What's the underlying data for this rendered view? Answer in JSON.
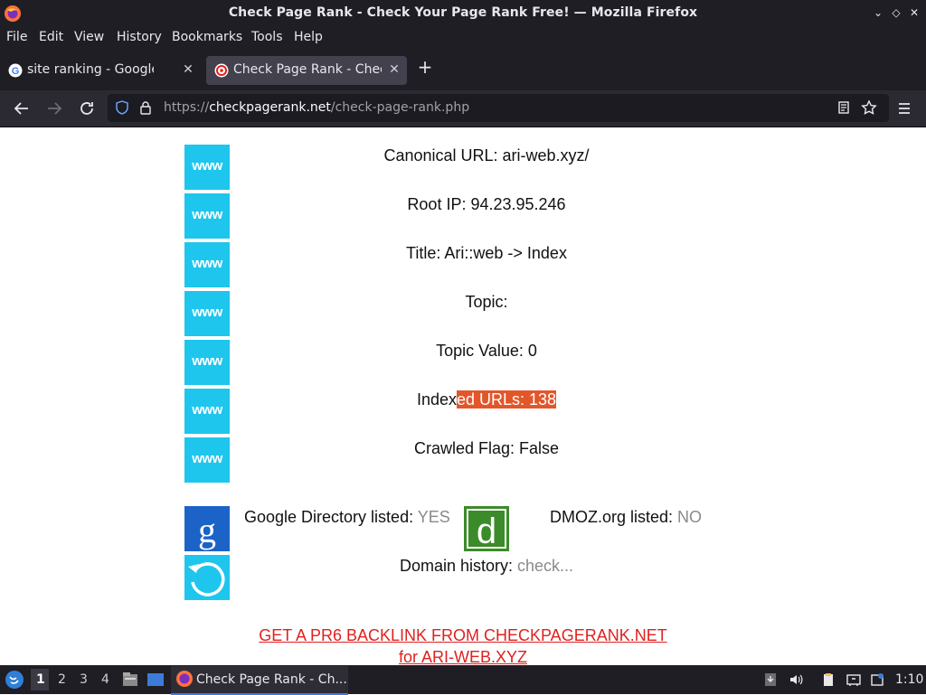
{
  "window": {
    "title": "Check Page Rank - Check Your Page Rank Free! — Mozilla Firefox"
  },
  "menu": [
    "File",
    "Edit",
    "View",
    "History",
    "Bookmarks",
    "Tools",
    "Help"
  ],
  "tabs": [
    {
      "label": "site ranking - Google Sea",
      "active": false
    },
    {
      "label": "Check Page Rank - Check",
      "active": true
    }
  ],
  "nav": {
    "url_prefix": "https://",
    "url_domain": "checkpagerank.net",
    "url_path": "/check-page-rank.php"
  },
  "page": {
    "www_icon_text": "www",
    "rows": [
      {
        "label": "Canonical URL: ari-web.xyz/"
      },
      {
        "label": "Root IP: 94.23.95.246"
      },
      {
        "label": "Title: Ari::web -> Index"
      },
      {
        "label": "Topic:"
      },
      {
        "label": "Topic Value: 0"
      },
      {
        "label_plain": "Index",
        "label_highlight": "ed URLs: 138"
      },
      {
        "label": "Crawled Flag: False"
      }
    ],
    "google_dir_label": "Google Directory listed: ",
    "google_dir_value": "YES",
    "google_icon_text": "g",
    "dmoz_icon_text": "d",
    "dmoz_label": "DMOZ.org listed: ",
    "dmoz_value": "NO",
    "domain_history_label": "Domain history: ",
    "domain_history_value": "check...",
    "backlink_line1": "GET A PR6 BACKLINK FROM CHECKPAGERANK.NET",
    "backlink_line2": "for ARI-WEB.XYZ"
  },
  "taskbar": {
    "workspaces": [
      "1",
      "2",
      "3",
      "4"
    ],
    "task_label": "Check Page Rank - Ch...",
    "clock": "1:10"
  },
  "colors": {
    "www_bg": "#1ec6ed",
    "highlight": "#e2562a",
    "link": "#e02020",
    "google_bg": "#1b63c6",
    "dmoz_bg": "#3b8b2a"
  }
}
